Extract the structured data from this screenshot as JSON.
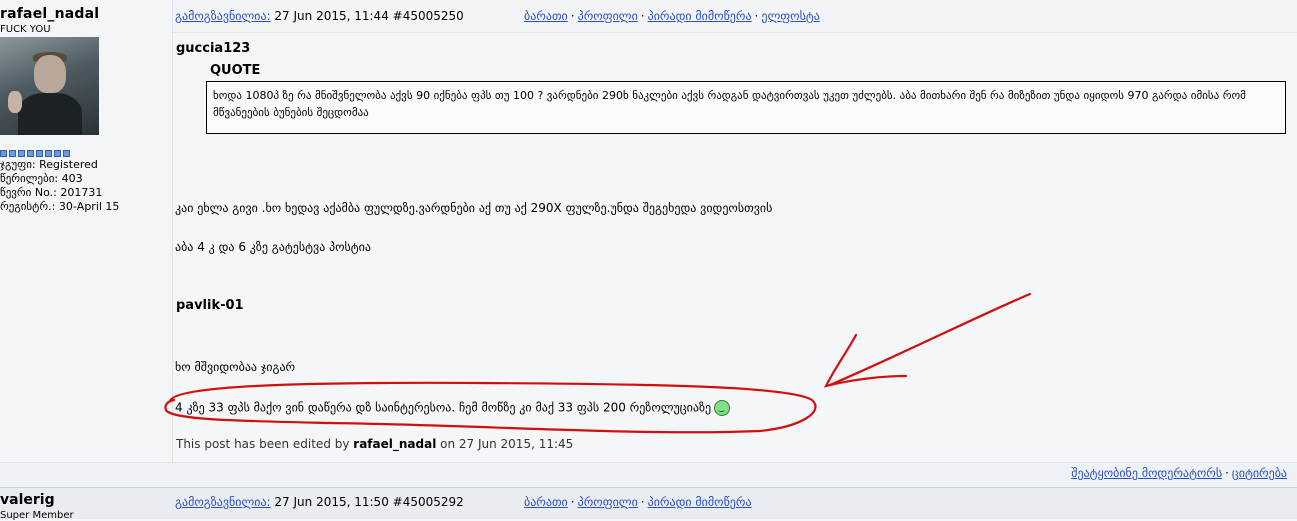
{
  "post1": {
    "username": "rafael_nadal",
    "user_title": "FUCK YOU",
    "group": "ჯგუფი: Registered",
    "posts": "წერილები: 403",
    "member_no": "წევრი No.: 201731",
    "registered": "რეგისტრ.: 30-April 15",
    "meta_label": "გამოგზავნილია:",
    "meta_date": " 27 Jun 2015, 11:44  #45005250",
    "links": [
      "ბარათი",
      "პროფილი",
      "პირადი მიმოწერა",
      "ელფოსტა"
    ],
    "quoted_author": "guccia123",
    "quote_label": "QUOTE",
    "quote_text": "ხოდა 1080პ ზე რა მნიშვნელობა აქვს 90 იქნება ფპს თუ 100 ? ვარდნები 290ხ ნაკლები აქვს რადგან დატვირთვას უკეთ უძლებს. აბა მითხარი შენ რა მიზეზით უნდა იყიდოს 970 გარდა იმისა რომ მწვანეების ბუნების შეცდომაა",
    "line1": "კაი ეხლა გივი .ხო ხედავ აქამბა ფულდზე.ვარდნები აქ თუ აქ 290X ფულზე.უნდა შეგეხედა ვიდეოსთვის",
    "line2": "აბა 4 კ და 6 კზე გატესტვა პოსტია",
    "quoted_author2": "pavlik-01",
    "line3": "ხო მშვიდობაა ჯიგარ",
    "line4": "4 კზე 33 ფპს მაქო ვინ დაწერა დზ საინტერესოა. ჩემ მოწზე კი მაქ 33 ფპს 200 რეზოლუციაზე",
    "smiley_icon": "smiley-icon",
    "edited_prefix": "This post has been edited by ",
    "edited_user": "rafael_nadal",
    "edited_suffix": " on 27 Jun 2015, 11:45"
  },
  "footer": {
    "report_label": "შეატყობინე მოდერატორს",
    "quote_label": "ციტირება"
  },
  "post2": {
    "username": "valerig",
    "user_title": "Super Member",
    "meta_label": "გამოგზავნილია:",
    "meta_date": " 27 Jun 2015, 11:50  #45005292",
    "links": [
      "ბარათი",
      "პროფილი",
      "პირადი მიმოწერა"
    ]
  },
  "colors": {
    "link": "#2a4fbf",
    "annotation": "#d01010"
  }
}
